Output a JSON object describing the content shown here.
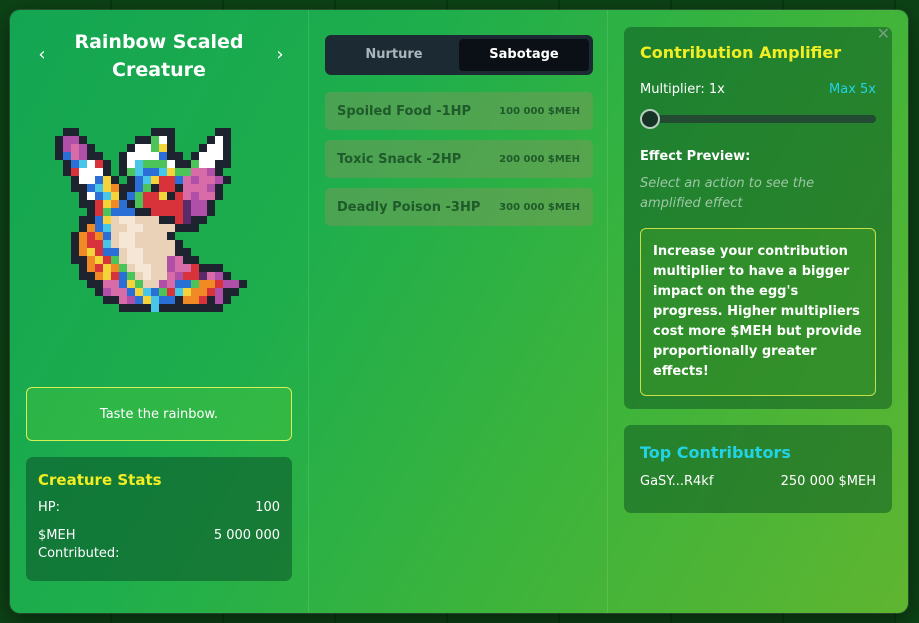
{
  "creature": {
    "title": "Rainbow Scaled Creature",
    "prev_icon": "chevron-left-icon",
    "next_icon": "chevron-right-icon",
    "tagline": "Taste the rainbow."
  },
  "stats": {
    "heading": "Creature Stats",
    "hp_label": "HP:",
    "hp_value": "100",
    "meh_label": "$MEH Contributed:",
    "meh_value": "5 000 000"
  },
  "tabs": [
    {
      "label": "Nurture",
      "active": false
    },
    {
      "label": "Sabotage",
      "active": true
    }
  ],
  "actions": [
    {
      "name": "Spoiled Food -1HP",
      "cost": "100 000 $MEH"
    },
    {
      "name": "Toxic Snack -2HP",
      "cost": "200 000 $MEH"
    },
    {
      "name": "Deadly Poison -3HP",
      "cost": "300 000 $MEH"
    }
  ],
  "amplifier": {
    "heading": "Contribution Amplifier",
    "multiplier_label": "Multiplier: 1x",
    "max_label": "Max 5x",
    "multiplier_value": 1,
    "multiplier_max": 5,
    "preview_heading": "Effect Preview:",
    "preview_placeholder": "Select an action to see the amplified effect",
    "info": "Increase your contribution multiplier to have a bigger impact on the egg's progress. Higher multipliers cost more $MEH but provide proportionally greater effects!"
  },
  "contributors": {
    "heading": "Top Contributors",
    "list": [
      {
        "address": "GaSY...R4kf",
        "amount": "250 000 $MEH"
      }
    ]
  },
  "close_icon": "close-icon",
  "colors": {
    "accent_yellow": "#f2ee24",
    "accent_cyan": "#22d3e6"
  }
}
